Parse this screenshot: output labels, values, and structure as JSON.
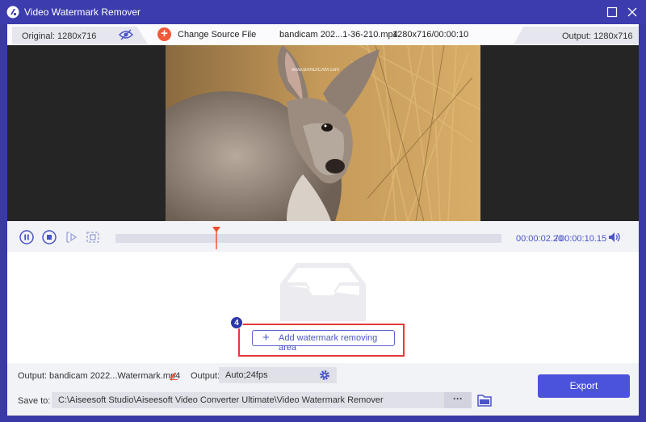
{
  "window": {
    "title": "Video Watermark Remover"
  },
  "infobar": {
    "original_label": "Original: 1280x716",
    "change_source_label": "Change Source File",
    "file_name": "bandicam 202...1-36-210.mp4",
    "file_info": "1280x716/00:00:10",
    "output_label": "Output: 1280x716"
  },
  "preview": {
    "watermark_text": "www.BANDICAM.com"
  },
  "player": {
    "current_time": "00:00:02.20",
    "separator": "/",
    "total_time": "00:00:10.15",
    "progress": 0.22
  },
  "editing": {
    "step_badge": "4",
    "add_area_label": "Add watermark removing area"
  },
  "bottom": {
    "output_label": "Output:",
    "output_file": "bandicam 2022...Watermark.mp4",
    "format_label": "Output:",
    "format_value": "Auto;24fps",
    "save_to_label": "Save to:",
    "save_path": "C:\\Aiseesoft Studio\\Aiseesoft Video Converter Ultimate\\Video Watermark Remover",
    "browse_label": "···",
    "export_label": "Export"
  },
  "colors": {
    "titlebar": "#3c3cae",
    "accent": "#4b52dc",
    "highlight": "#e5383b",
    "plus": "#f25a3c",
    "time_text": "#4a54c8"
  },
  "icons": [
    "app-logo-icon",
    "maximize-icon",
    "close-icon",
    "eye-icon",
    "add-circle-icon",
    "pause-icon",
    "stop-icon",
    "prev-frame-icon",
    "next-frame-icon",
    "playhead-marker-icon",
    "volume-icon",
    "tray-icon",
    "edit-pencil-icon",
    "gear-icon",
    "folder-icon",
    "plus-icon"
  ]
}
